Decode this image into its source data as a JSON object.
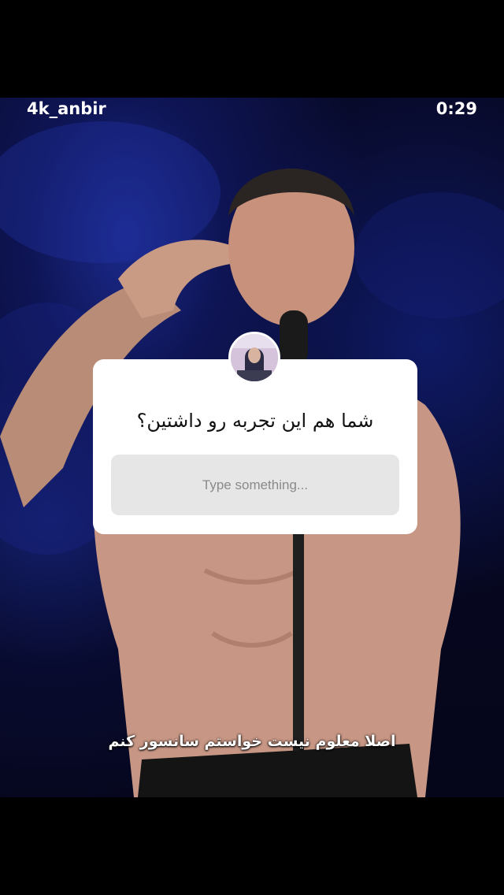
{
  "story": {
    "username": "4k_anbir",
    "timer": "0:29"
  },
  "question_sticker": {
    "question": "شما هم این تجربه رو داشتین؟",
    "input_placeholder": "Type something..."
  },
  "caption": "اصلا معلوم نیست خواستم سانسور کنم"
}
